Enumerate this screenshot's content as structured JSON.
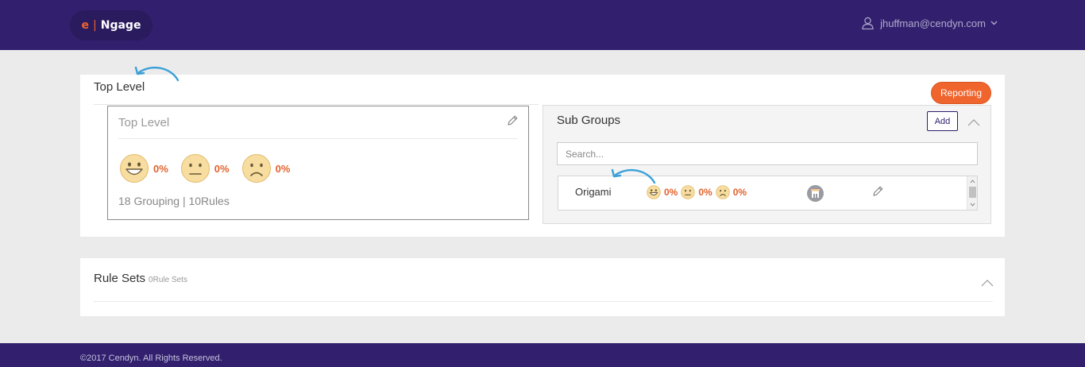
{
  "header": {
    "logo_e": "e",
    "logo_sep": "|",
    "logo_name": "Ngage",
    "user_email": "jhuffman@cendyn.com"
  },
  "top_level": {
    "title": "Top Level",
    "reporting_label": "Reporting",
    "card": {
      "title": "Top Level",
      "sentiments": [
        {
          "icon": "happy-face-icon",
          "value": "0%"
        },
        {
          "icon": "neutral-face-icon",
          "value": "0%"
        },
        {
          "icon": "sad-face-icon",
          "value": "0%"
        }
      ],
      "stats": "18 Grouping | 10Rules"
    },
    "sub_groups": {
      "title": "Sub Groups",
      "add_label": "Add",
      "search_placeholder": "Search...",
      "rows": [
        {
          "name": "Origami",
          "sentiments": [
            {
              "icon": "happy-face-icon",
              "value": "0%"
            },
            {
              "icon": "neutral-face-icon",
              "value": "0%"
            },
            {
              "icon": "sad-face-icon",
              "value": "0%"
            }
          ]
        }
      ]
    }
  },
  "rule_sets": {
    "title": "Rule Sets",
    "count": "0Rule Sets"
  },
  "footer": {
    "copyright": "©2017 Cendyn. All Rights Reserved."
  },
  "colors": {
    "brand_purple": "#32206e",
    "accent_orange": "#f0642d",
    "pointer_blue": "#3aa0d8"
  }
}
